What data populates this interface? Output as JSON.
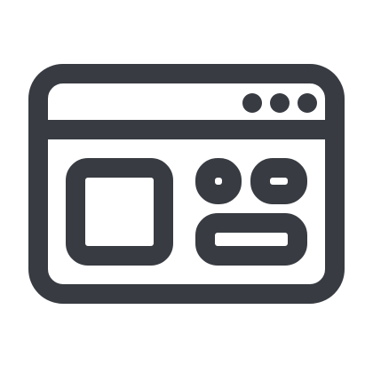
{
  "icon": {
    "name": "browser-window-layout-icon",
    "stroke_color": "#383c42",
    "background_color": "#ffffff",
    "window_dots": [
      "dot-1",
      "dot-2",
      "dot-3"
    ]
  }
}
